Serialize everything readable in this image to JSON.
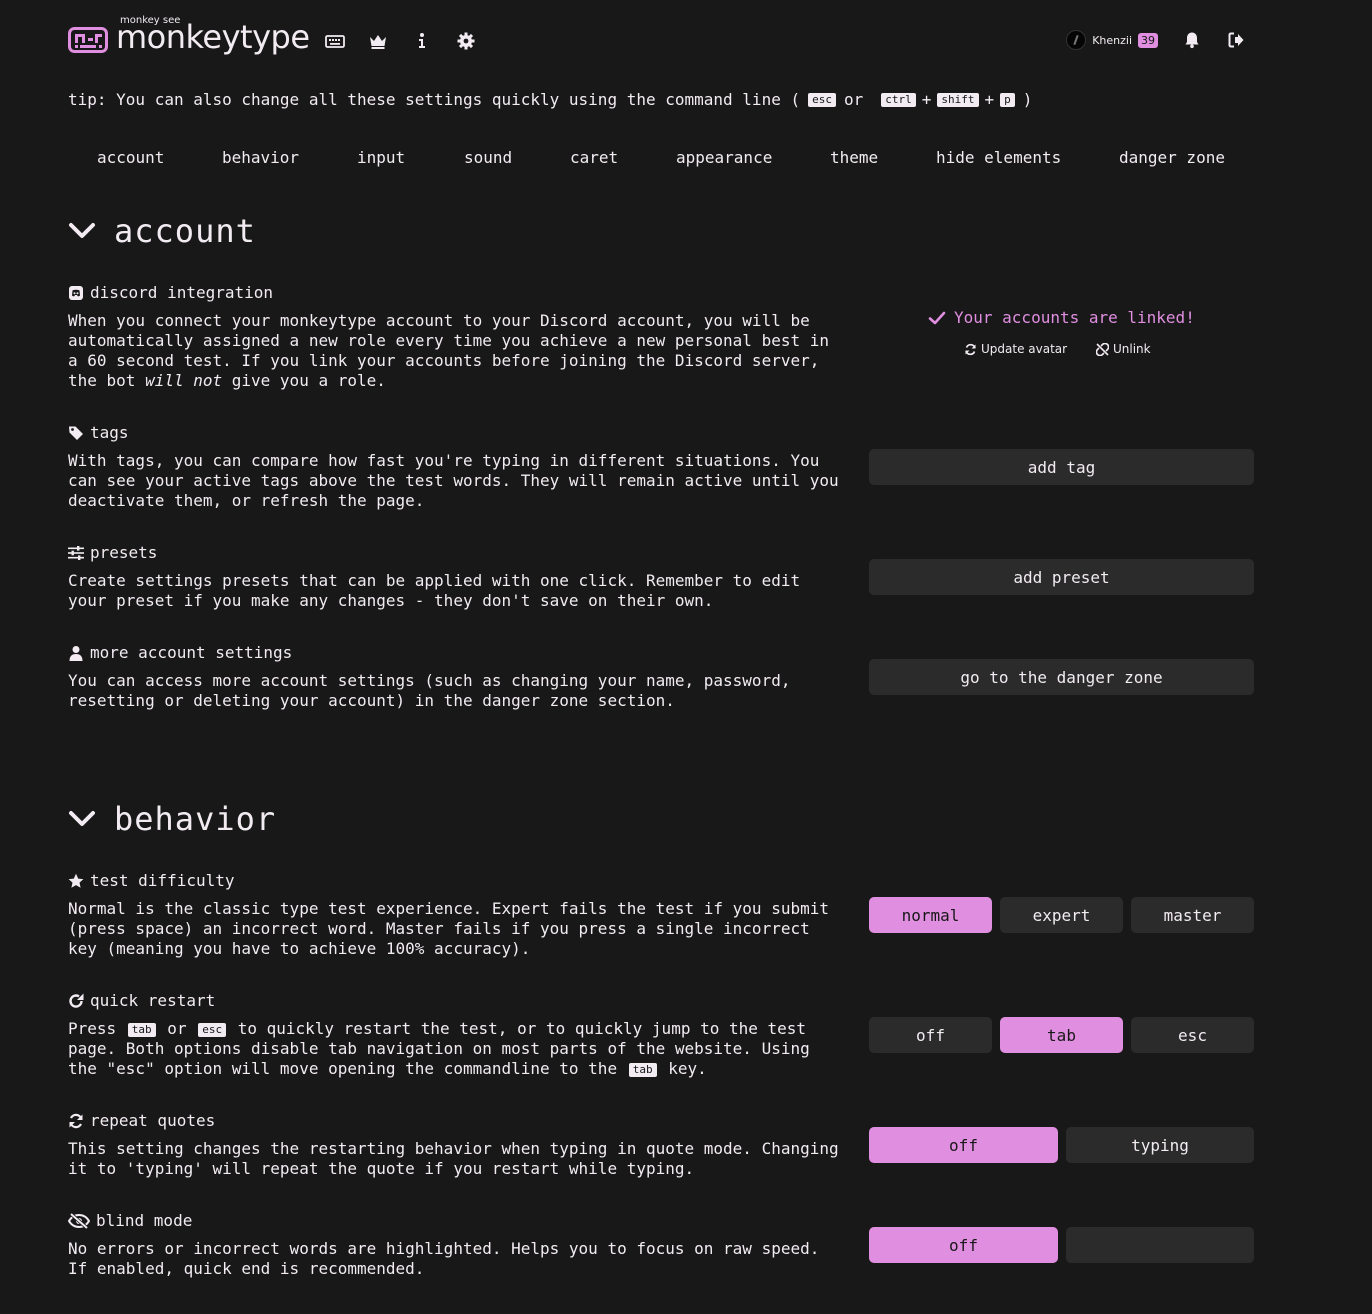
{
  "header": {
    "brand_sup": "monkey see",
    "brand_name": "monkeytype",
    "user_name": "Khenzii",
    "user_level": "39"
  },
  "tip": {
    "prefix": "tip: You can also change all these settings quickly using the command line (",
    "key_esc": "esc",
    "or": "or",
    "key_ctrl": "ctrl",
    "plus": "+",
    "key_shift": "shift",
    "key_p": "p",
    "suffix": ")"
  },
  "section_nav": [
    "account",
    "behavior",
    "input",
    "sound",
    "caret",
    "appearance",
    "theme",
    "hide elements",
    "danger zone"
  ],
  "sections": {
    "account": {
      "title": "account"
    },
    "behavior": {
      "title": "behavior"
    }
  },
  "discord": {
    "title": "discord integration",
    "desc_1": "When you connect your monkeytype account to your Discord account, you will be automatically assigned a new role every time you achieve a new personal best in a 60 second test. If you link your accounts before joining the Discord server, the bot ",
    "desc_em": "will not",
    "desc_2": " give you a role.",
    "linked_text": "Your accounts are linked!",
    "update_avatar": "Update avatar",
    "unlink": "Unlink"
  },
  "tags": {
    "title": "tags",
    "desc": "With tags, you can compare how fast you're typing in different situations. You can see your active tags above the test words. They will remain active until you deactivate them, or refresh the page.",
    "button": "add tag"
  },
  "presets": {
    "title": "presets",
    "desc": "Create settings presets that can be applied with one click. Remember to edit your preset if you make any changes - they don't save on their own.",
    "button": "add preset"
  },
  "more_account": {
    "title": "more account settings",
    "desc": "You can access more account settings (such as changing your name, password, resetting or deleting your account) in the danger zone section.",
    "button": "go to the danger zone"
  },
  "test_difficulty": {
    "title": "test difficulty",
    "desc": "Normal is the classic type test experience. Expert fails the test if you submit (press space) an incorrect word. Master fails if you press a single incorrect key (meaning you have to achieve 100% accuracy).",
    "options": [
      "normal",
      "expert",
      "master"
    ],
    "selected": "normal"
  },
  "quick_restart": {
    "title": "quick restart",
    "desc_1": "Press ",
    "key_tab": "tab",
    "desc_2": " or ",
    "key_esc": "esc",
    "desc_3": " to quickly restart the test, or to quickly jump to the test page. Both options disable tab navigation on most parts of the website. Using the \"esc\" option will move opening the commandline to the ",
    "desc_4": " key.",
    "options": [
      "off",
      "tab",
      "esc"
    ],
    "selected": "tab"
  },
  "repeat_quotes": {
    "title": "repeat quotes",
    "desc": "This setting changes the restarting behavior when typing in quote mode. Changing it to 'typing' will repeat the quote if you restart while typing.",
    "options": [
      "off",
      "typing"
    ],
    "selected": "off"
  },
  "blind_mode": {
    "title": "blind mode",
    "desc": "No errors or incorrect words are highlighted. Helps you to focus on raw speed. If enabled, quick end is recommended.",
    "options": [
      "off",
      ""
    ],
    "selected": "off"
  },
  "colors": {
    "background": "#181818",
    "text": "#f2ecf2",
    "accent": "#e08ee0",
    "button": "#2b2b2b"
  },
  "icons": {
    "nav": [
      "keyboard-icon",
      "crown-icon",
      "info-icon",
      "gear-icon"
    ],
    "header_right": [
      "bell-icon",
      "sign-out-icon"
    ]
  }
}
